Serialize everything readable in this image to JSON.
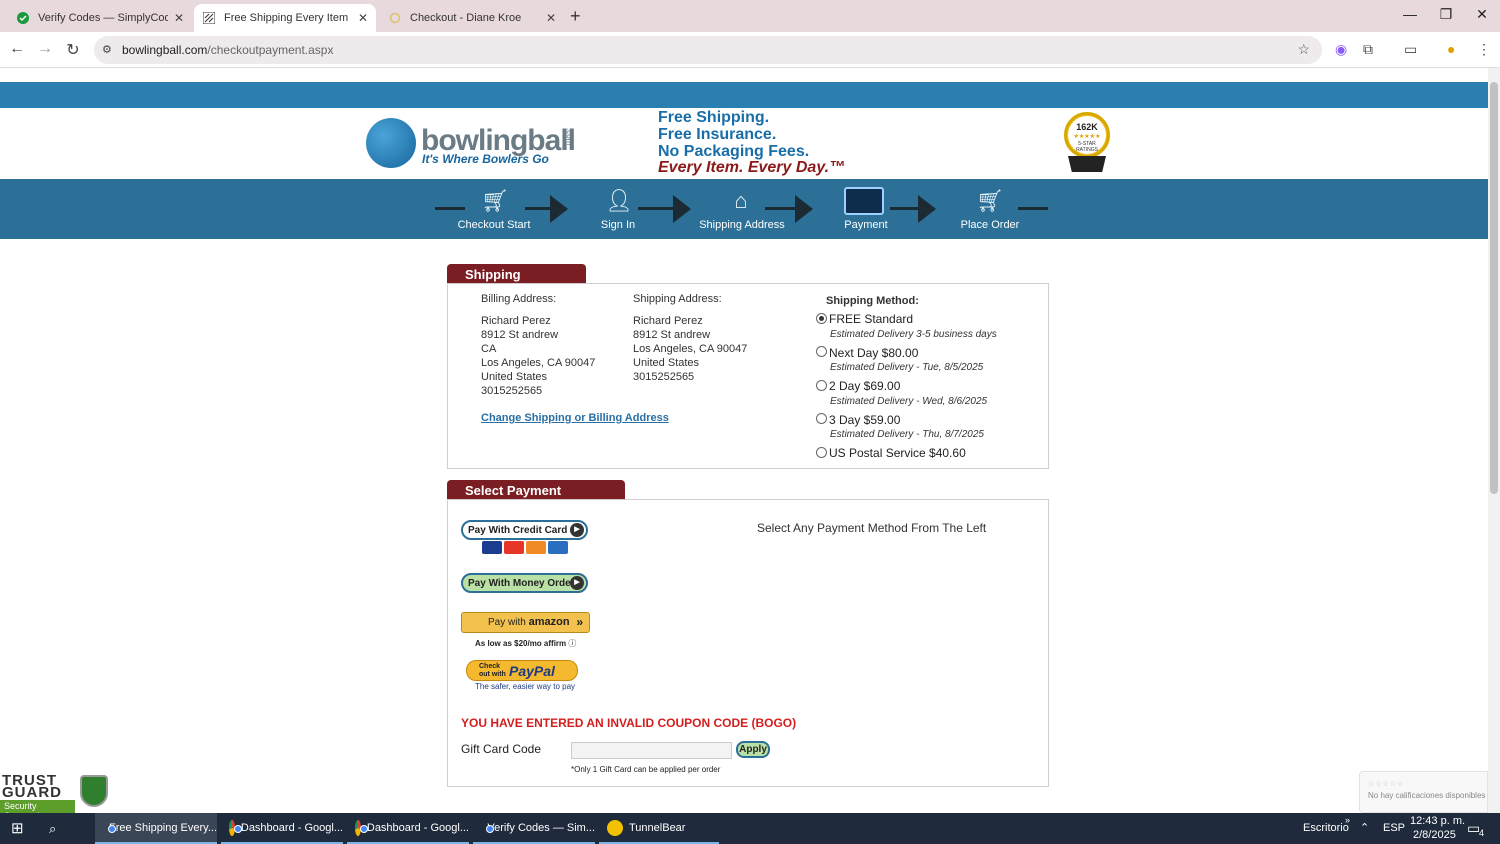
{
  "browser": {
    "tabs": [
      {
        "title": "Verify Codes — SimplyCodes",
        "icon": "simplycodes-icon"
      },
      {
        "title": "Free Shipping Every Item Every",
        "icon": "bowlingball-icon",
        "active": true
      },
      {
        "title": "Checkout - Diane Kroe",
        "icon": "spinner-icon"
      }
    ],
    "url_domain": "bowlingball.com",
    "url_path": "/checkoutpayment.aspx"
  },
  "site": {
    "logo_text": "bowlingball",
    "logo_com": ".com",
    "tagline": "It's Where Bowlers Go",
    "promo": [
      "Free Shipping.",
      "Free Insurance.",
      "No Packaging Fees.",
      "Every Item. Every Day.™"
    ],
    "badge": {
      "count": "162K",
      "stars": "★★★★★",
      "label": "5-STAR RATINGS"
    }
  },
  "steps": [
    {
      "label": "Checkout Start",
      "icon": "cart-icon"
    },
    {
      "label": "Sign In",
      "icon": "person-icon"
    },
    {
      "label": "Shipping Address",
      "icon": "house-icon"
    },
    {
      "label": "Payment",
      "icon": "credit-card-icon",
      "active": true
    },
    {
      "label": "Place Order",
      "icon": "cart-icon"
    }
  ],
  "shipping_options": {
    "heading": "Shipping Options",
    "billing_label": "Billing Address:",
    "billing": [
      "Richard Perez",
      "8912 St andrew",
      "CA",
      "Los Angeles, CA 90047",
      "United States",
      "3015252565"
    ],
    "shipping_label": "Shipping Address:",
    "shipping": [
      "Richard Perez",
      "8912 St andrew",
      "Los Angeles, CA 90047",
      "United States",
      "3015252565"
    ],
    "change_link": "Change Shipping or Billing Address",
    "method_label": "Shipping Method:",
    "methods": [
      {
        "label": "FREE Standard",
        "est": "Estimated Delivery 3-5 business days",
        "checked": true
      },
      {
        "label": "Next Day $80.00",
        "est": "Estimated Delivery - Tue, 8/5/2025"
      },
      {
        "label": "2 Day $69.00",
        "est": "Estimated Delivery - Wed, 8/6/2025"
      },
      {
        "label": "3 Day $59.00",
        "est": "Estimated Delivery - Thu, 8/7/2025"
      },
      {
        "label": "US Postal Service $40.60",
        "est": ""
      }
    ]
  },
  "payment": {
    "heading": "Select Payment Method",
    "prompt": "Select Any Payment Method From The Left",
    "credit_card": "Pay With Credit Card",
    "money_order": "Pay With Money Order",
    "amazon_pre": "Pay with",
    "amazon_brand": "amazon",
    "affirm": "As low as $20/mo affirm",
    "paypal_pre": "Check out with",
    "paypal_logo": "PayPal",
    "paypal_sub": "The safer, easier way to pay",
    "coupon_error": "YOU HAVE ENTERED AN INVALID COUPON CODE (BOGO)",
    "gift_label": "Gift Card Code",
    "gift_placeholder": "",
    "gift_apply": "Apply",
    "gift_note": "*Only 1 Gift Card can be applied per order"
  },
  "trust_guard": {
    "title": "TRUST GUARD",
    "sub": "Security Scanned"
  },
  "ratings_widget": {
    "stars": "☆☆☆☆☆",
    "text": "No hay calificaciones disponibles"
  },
  "taskbar": {
    "items": [
      {
        "label": "Free Shipping Every..."
      },
      {
        "label": "Dashboard - Googl..."
      },
      {
        "label": "Dashboard - Googl..."
      },
      {
        "label": "Verify Codes — Sim..."
      },
      {
        "label": "TunnelBear"
      }
    ],
    "desktop": "Escritorio",
    "lang": "ESP",
    "time": "12:43 p. m.",
    "date": "2/8/2025",
    "notif_count": "4"
  },
  "colors": {
    "accent": "#2c6f97",
    "section_head": "#7a1e24",
    "error": "#d41e1e",
    "link": "#2a6fa4"
  }
}
